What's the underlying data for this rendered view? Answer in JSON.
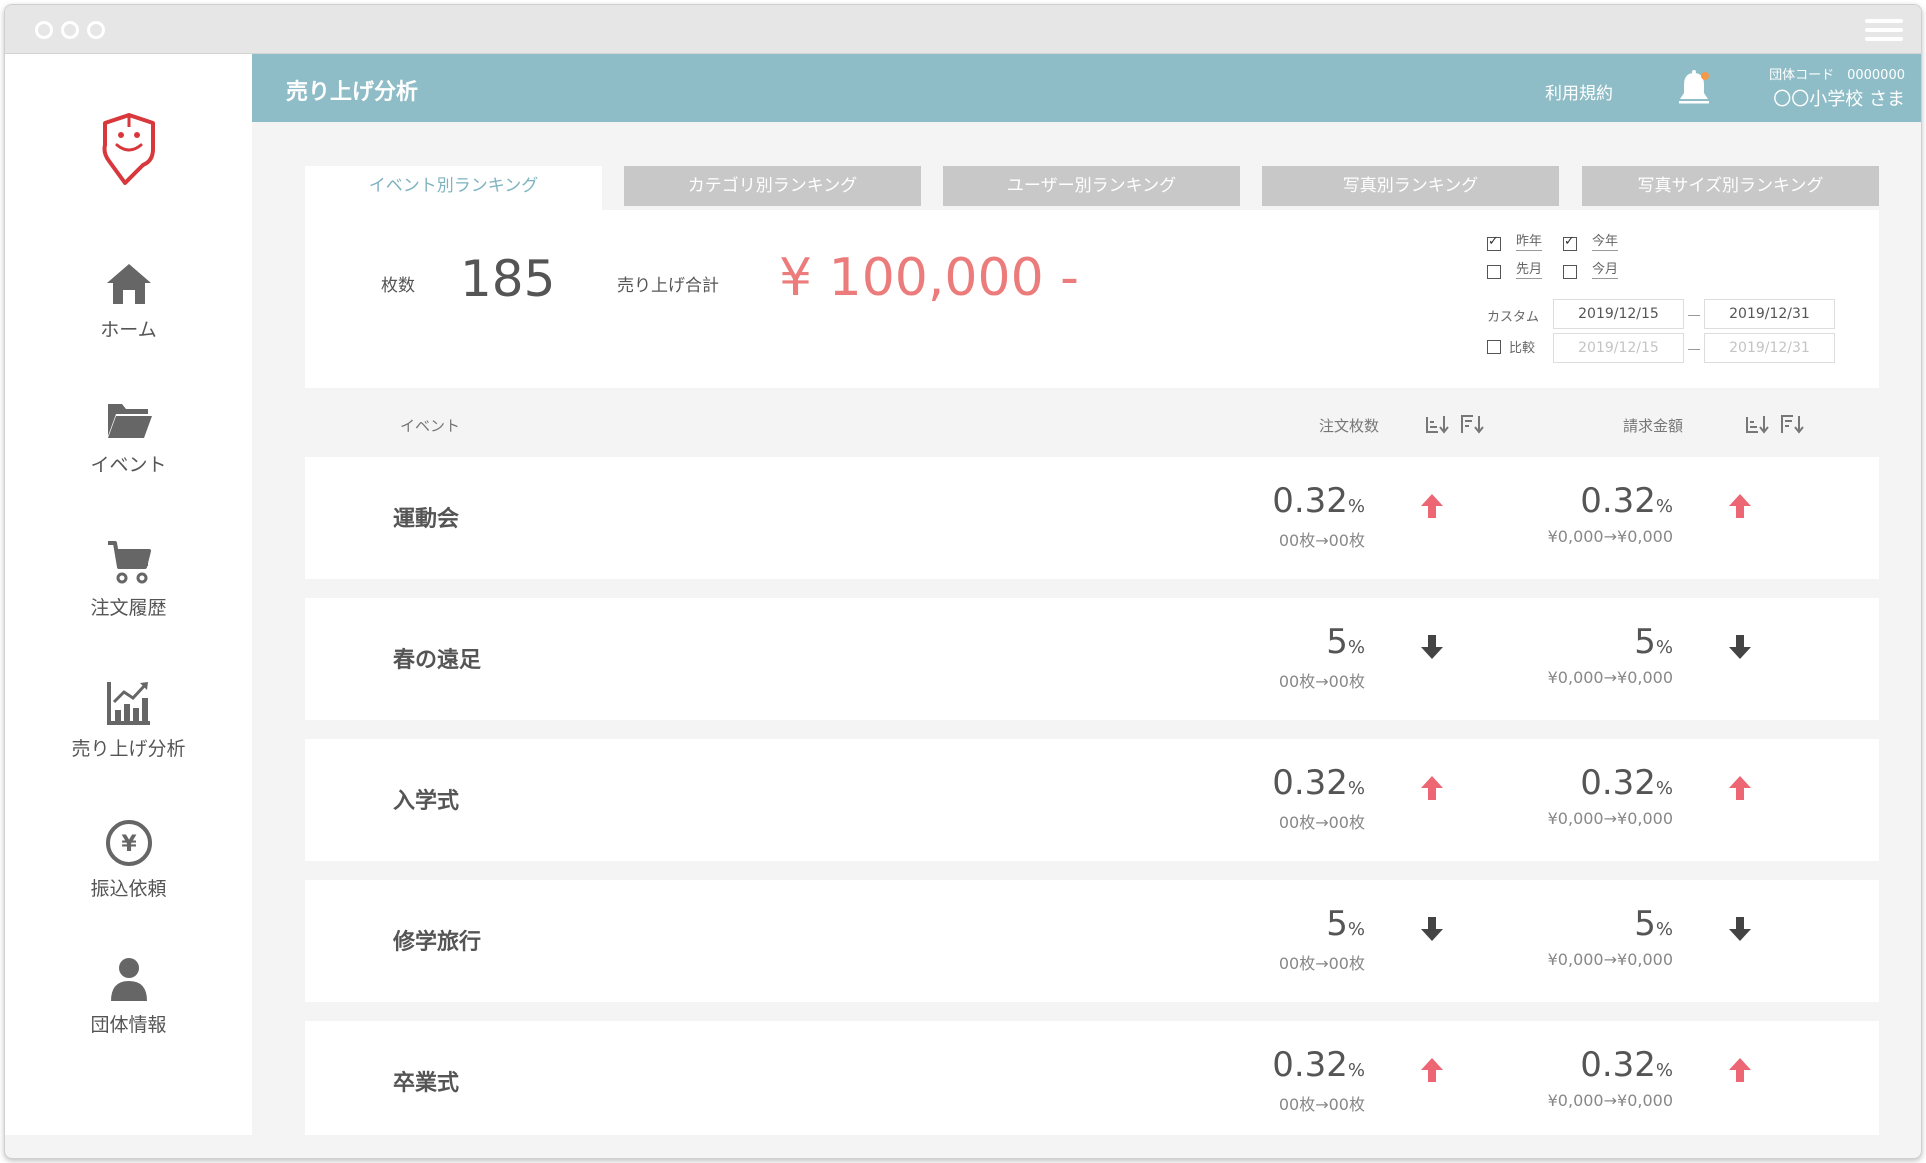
{
  "header": {
    "title": "売り上げ分析",
    "terms": "利用規約",
    "org_code": "団体コード　0000000",
    "org_name": "〇〇小学校 さま"
  },
  "sidebar": {
    "items": [
      {
        "label": "ホーム",
        "icon": "home-icon"
      },
      {
        "label": "イベント",
        "icon": "folder-icon"
      },
      {
        "label": "注文履歴",
        "icon": "cart-icon"
      },
      {
        "label": "売り上げ分析",
        "icon": "chart-icon"
      },
      {
        "label": "振込依頼",
        "icon": "yen-coin-icon"
      },
      {
        "label": "団体情報",
        "icon": "user-icon"
      }
    ]
  },
  "tabs": [
    {
      "label": "イベント別ランキング",
      "active": true
    },
    {
      "label": "カテゴリ別ランキング",
      "active": false
    },
    {
      "label": "ユーザー別ランキング",
      "active": false
    },
    {
      "label": "写真別ランキング",
      "active": false
    },
    {
      "label": "写真サイズ別ランキング",
      "active": false
    }
  ],
  "summary": {
    "count_label": "枚数",
    "count_value": "185",
    "total_label": "売り上げ合計",
    "total_value": "¥ 100,000 -"
  },
  "filters": {
    "last_year": {
      "label": "昨年",
      "checked": true
    },
    "this_year": {
      "label": "今年",
      "checked": true
    },
    "last_month": {
      "label": "先月",
      "checked": false
    },
    "this_month": {
      "label": "今月",
      "checked": false
    },
    "custom_label": "カスタム",
    "custom_from": "2019/12/15",
    "custom_to": "2019/12/31",
    "compare": {
      "label": "比較",
      "checked": false
    },
    "compare_from": "2019/12/15",
    "compare_to": "2019/12/31"
  },
  "columns": {
    "event": "イベント",
    "qty": "注文枚数",
    "amount": "請求金額"
  },
  "rows": [
    {
      "name": "運動会",
      "qty_value": "0.32",
      "qty_unit": "%",
      "qty_trend": "up",
      "qty_detail": "00枚→00枚",
      "amt_value": "0.32",
      "amt_unit": "%",
      "amt_trend": "up",
      "amt_detail": "¥0,000→¥0,000"
    },
    {
      "name": "春の遠足",
      "qty_value": "5",
      "qty_unit": "%",
      "qty_trend": "down",
      "qty_detail": "00枚→00枚",
      "amt_value": "5",
      "amt_unit": "%",
      "amt_trend": "down",
      "amt_detail": "¥0,000→¥0,000"
    },
    {
      "name": "入学式",
      "qty_value": "0.32",
      "qty_unit": "%",
      "qty_trend": "up",
      "qty_detail": "00枚→00枚",
      "amt_value": "0.32",
      "amt_unit": "%",
      "amt_trend": "up",
      "amt_detail": "¥0,000→¥0,000"
    },
    {
      "name": "修学旅行",
      "qty_value": "5",
      "qty_unit": "%",
      "qty_trend": "down",
      "qty_detail": "00枚→00枚",
      "amt_value": "5",
      "amt_unit": "%",
      "amt_trend": "down",
      "amt_detail": "¥0,000→¥0,000"
    },
    {
      "name": "卒業式",
      "qty_value": "0.32",
      "qty_unit": "%",
      "qty_trend": "up",
      "qty_detail": "00枚→00枚",
      "amt_value": "0.32",
      "amt_unit": "%",
      "amt_trend": "up",
      "amt_detail": "¥0,000→¥0,000"
    }
  ],
  "colors": {
    "header_bg": "#8fbdc7",
    "accent_red": "#ec7b7b",
    "up_arrow": "#ec6674",
    "down_arrow": "#444444",
    "tab_inactive": "#c8c8c8",
    "tab_active_text": "#7fb3c0"
  }
}
